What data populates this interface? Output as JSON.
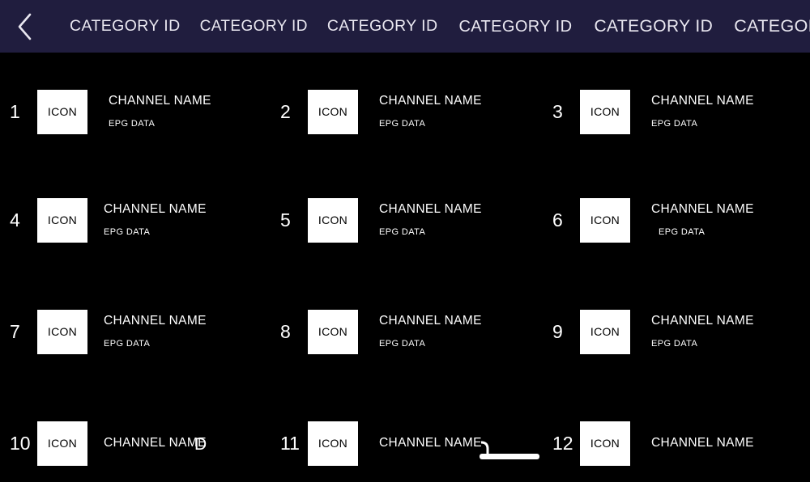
{
  "header": {
    "back_icon": "chevron-left-icon",
    "tabs": [
      {
        "label": "CATEGORY ID"
      },
      {
        "label": "CATEGORY ID"
      },
      {
        "label": "CATEGORY ID"
      },
      {
        "label": "CATEGORY ID"
      },
      {
        "label": "CATEGORY ID"
      },
      {
        "label": "CATEGORY ID"
      }
    ],
    "background_color": "#201d3e",
    "text_color": "#e9e7f0"
  },
  "grid": {
    "background_color": "#000000",
    "columns": 3,
    "rows": 4,
    "items": [
      {
        "number": "1",
        "icon_label": "ICON",
        "name": "CHANNEL NAME",
        "epg": "EPG DATA"
      },
      {
        "number": "2",
        "icon_label": "ICON",
        "name": "CHANNEL NAME",
        "epg": "EPG DATA"
      },
      {
        "number": "3",
        "icon_label": "ICON",
        "name": "CHANNEL NAME",
        "epg": "EPG DATA"
      },
      {
        "number": "4",
        "icon_label": "ICON",
        "name": "CHANNEL NAME",
        "epg": "EPG DATA"
      },
      {
        "number": "5",
        "icon_label": "ICON",
        "name": "CHANNEL NAME",
        "epg": "EPG DATA"
      },
      {
        "number": "6",
        "icon_label": "ICON",
        "name": "CHANNEL NAME",
        "epg": "EPG DATA"
      },
      {
        "number": "7",
        "icon_label": "ICON",
        "name": "CHANNEL NAME",
        "epg": "EPG DATA"
      },
      {
        "number": "8",
        "icon_label": "ICON",
        "name": "CHANNEL NAME",
        "epg": "EPG DATA"
      },
      {
        "number": "9",
        "icon_label": "ICON",
        "name": "CHANNEL NAME",
        "epg": "EPG DATA"
      },
      {
        "number": "10",
        "icon_label": "ICON",
        "name": "CHANNEL NAME",
        "epg": "",
        "trailing": "D"
      },
      {
        "number": "11",
        "icon_label": "ICON",
        "name": "CHANNEL NAME",
        "epg": ""
      },
      {
        "number": "12",
        "icon_label": "ICON",
        "name": "CHANNEL NAME",
        "epg": ""
      }
    ]
  }
}
